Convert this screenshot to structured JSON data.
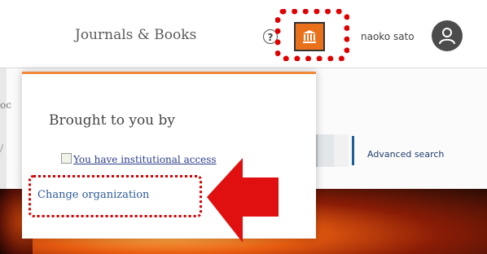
{
  "header": {
    "nav_link": "Journals & Books",
    "help_symbol": "?",
    "institution_icon": "institution-building-icon",
    "user_name": "naoko sato",
    "avatar_icon": "user-avatar-icon"
  },
  "background": {
    "fragment_1": "oc",
    "fragment_2": "/",
    "advanced_search": "Advanced search"
  },
  "popup": {
    "heading": "Brought to you by",
    "institution_access_link": "You have institutional access",
    "change_organization": "Change organization"
  },
  "annotations": {
    "highlight_color": "#e00000",
    "arrow_color": "#e01010"
  },
  "colors": {
    "institution_button": "#e9711c",
    "popup_accent": "#f08a3a",
    "link": "#2e5a9b"
  }
}
